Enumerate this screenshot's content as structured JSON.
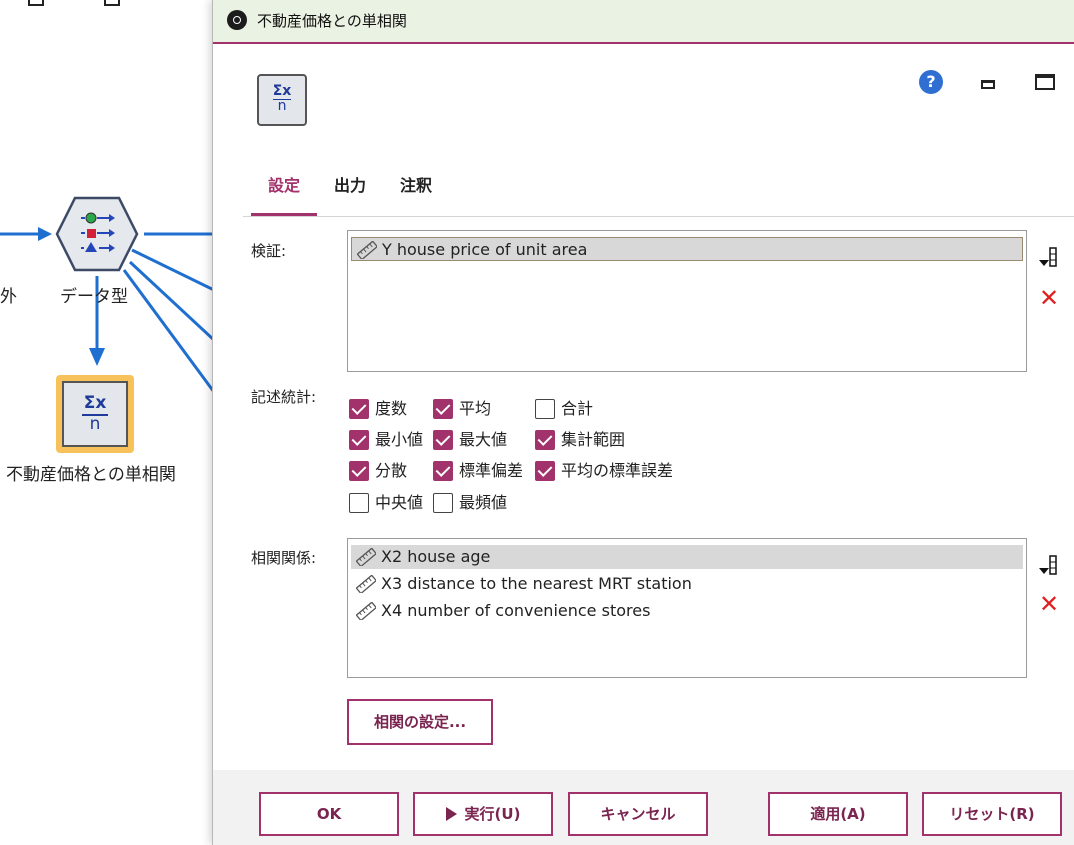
{
  "canvas": {
    "node_label_left_partial": "外",
    "type_node_label": "データ型",
    "stats_node_label": "不動産価格との単相関"
  },
  "dialog": {
    "title": "不動産価格との単相関",
    "help_symbol": "?",
    "node_icon_sigma": "Σx",
    "node_icon_n": "n",
    "tabs": [
      {
        "label": "設定",
        "active": true
      },
      {
        "label": "出力",
        "active": false
      },
      {
        "label": "注釈",
        "active": false
      }
    ],
    "examine": {
      "label": "検証:",
      "items": [
        "Y house price of unit area"
      ]
    },
    "statistics": {
      "label": "記述統計:",
      "options": [
        {
          "label": "度数",
          "checked": true
        },
        {
          "label": "平均",
          "checked": true
        },
        {
          "label": "合計",
          "checked": false
        },
        {
          "label": "最小値",
          "checked": true
        },
        {
          "label": "最大値",
          "checked": true
        },
        {
          "label": "集計範囲",
          "checked": true
        },
        {
          "label": "分散",
          "checked": true
        },
        {
          "label": "標準偏差",
          "checked": true
        },
        {
          "label": "平均の標準誤差",
          "checked": true
        },
        {
          "label": "中央値",
          "checked": false
        },
        {
          "label": "最頻値",
          "checked": false
        }
      ]
    },
    "correlate": {
      "label": "相関関係:",
      "items": [
        "X2 house age",
        "X3 distance to the nearest MRT station",
        "X4 number of convenience stores"
      ],
      "settings_button": "相関の設定..."
    },
    "delete_icon": "✕",
    "buttons": {
      "ok": "OK",
      "run": "実行(U)",
      "cancel": "キャンセル",
      "apply": "適用(A)",
      "reset": "リセット(R)"
    },
    "colors": {
      "accent": "#a2326b",
      "titlebar": "#eaf2e3",
      "delete": "#e02020",
      "canvas_link": "#1f6fd1"
    }
  }
}
